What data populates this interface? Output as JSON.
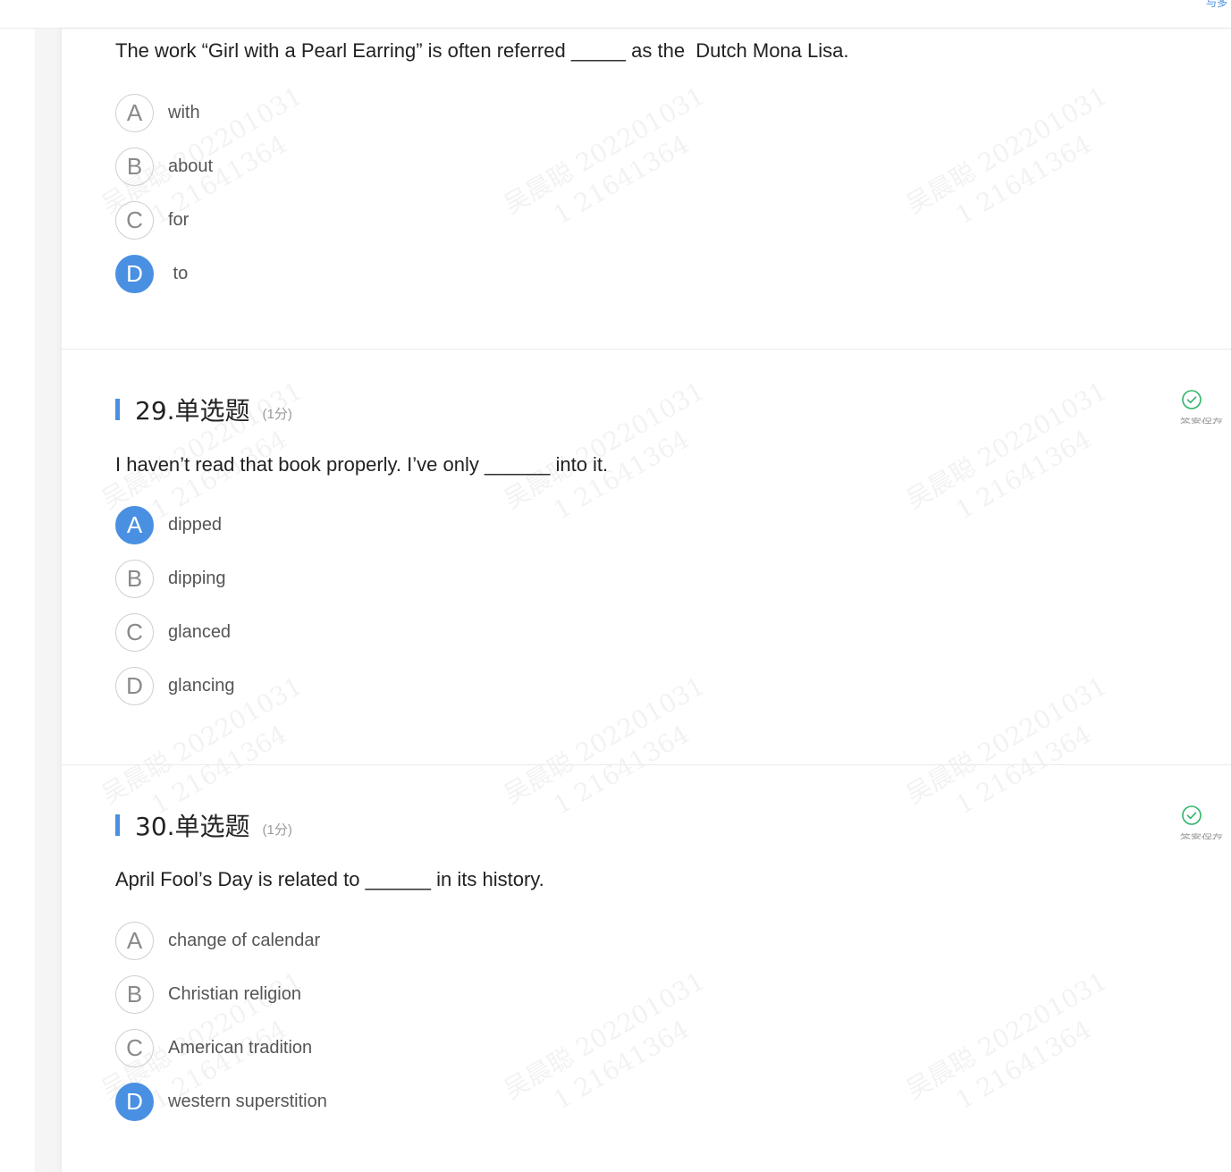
{
  "header": {
    "corner_link": "与多"
  },
  "watermark": {
    "line1": "吴晨聪 202201031",
    "line2": "1 21641364"
  },
  "questions": [
    {
      "number": "",
      "score": "",
      "stem": "The work “Girl with a Pearl Earring” is often referred _____ as the  Dutch Mona Lisa.",
      "options": [
        {
          "letter": "A",
          "text": "with"
        },
        {
          "letter": "B",
          "text": "about"
        },
        {
          "letter": "C",
          "text": "for"
        },
        {
          "letter": "D",
          "text": " to"
        }
      ],
      "selected": "D",
      "status": ""
    },
    {
      "number": "29.单选题",
      "score": "(1分)",
      "stem": "I haven’t read that book properly. I’ve only ______ into it.",
      "options": [
        {
          "letter": "A",
          "text": "dipped"
        },
        {
          "letter": "B",
          "text": "dipping"
        },
        {
          "letter": "C",
          "text": "glanced"
        },
        {
          "letter": "D",
          "text": "glancing"
        }
      ],
      "selected": "A",
      "status": "答案保存"
    },
    {
      "number": "30.单选题",
      "score": "(1分)",
      "stem": "April Fool’s Day is related to ______ in its history.",
      "options": [
        {
          "letter": "A",
          "text": "change of calendar"
        },
        {
          "letter": "B",
          "text": "Christian religion"
        },
        {
          "letter": "C",
          "text": "American tradition"
        },
        {
          "letter": "D",
          "text": "western superstition"
        }
      ],
      "selected": "D",
      "status": "答案保存"
    }
  ],
  "colors": {
    "accent": "#4a90e2",
    "saved_check": "#2fb36b"
  }
}
